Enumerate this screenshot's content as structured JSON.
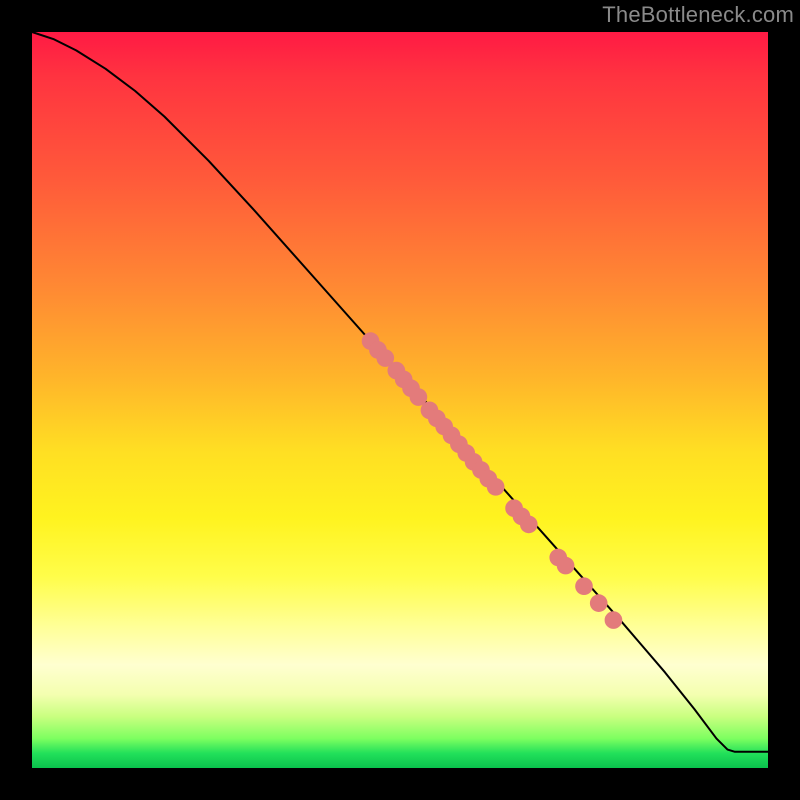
{
  "watermark": "TheBottleneck.com",
  "chart_data": {
    "type": "line",
    "title": "",
    "xlabel": "",
    "ylabel": "",
    "xlim": [
      0,
      100
    ],
    "ylim": [
      0,
      100
    ],
    "grid": false,
    "legend": false,
    "curve": [
      {
        "x": 0,
        "y": 100
      },
      {
        "x": 3,
        "y": 99
      },
      {
        "x": 6,
        "y": 97.5
      },
      {
        "x": 10,
        "y": 95
      },
      {
        "x": 14,
        "y": 92
      },
      {
        "x": 18,
        "y": 88.5
      },
      {
        "x": 24,
        "y": 82.5
      },
      {
        "x": 30,
        "y": 76
      },
      {
        "x": 38,
        "y": 67
      },
      {
        "x": 46,
        "y": 58
      },
      {
        "x": 56,
        "y": 47
      },
      {
        "x": 64,
        "y": 38
      },
      {
        "x": 72,
        "y": 29
      },
      {
        "x": 80,
        "y": 20
      },
      {
        "x": 86,
        "y": 13
      },
      {
        "x": 90,
        "y": 8
      },
      {
        "x": 93,
        "y": 4
      },
      {
        "x": 94.5,
        "y": 2.5
      },
      {
        "x": 95.5,
        "y": 2.2
      },
      {
        "x": 100,
        "y": 2.2
      }
    ],
    "markers": [
      {
        "x": 46.0,
        "y": 58.0
      },
      {
        "x": 47.0,
        "y": 56.8
      },
      {
        "x": 48.0,
        "y": 55.7
      },
      {
        "x": 49.5,
        "y": 54.0
      },
      {
        "x": 50.5,
        "y": 52.8
      },
      {
        "x": 51.5,
        "y": 51.6
      },
      {
        "x": 52.5,
        "y": 50.4
      },
      {
        "x": 54.0,
        "y": 48.6
      },
      {
        "x": 55.0,
        "y": 47.5
      },
      {
        "x": 56.0,
        "y": 46.4
      },
      {
        "x": 57.0,
        "y": 45.2
      },
      {
        "x": 58.0,
        "y": 44.0
      },
      {
        "x": 59.0,
        "y": 42.8
      },
      {
        "x": 60.0,
        "y": 41.6
      },
      {
        "x": 61.0,
        "y": 40.5
      },
      {
        "x": 62.0,
        "y": 39.3
      },
      {
        "x": 63.0,
        "y": 38.2
      },
      {
        "x": 65.5,
        "y": 35.3
      },
      {
        "x": 66.5,
        "y": 34.2
      },
      {
        "x": 67.5,
        "y": 33.1
      },
      {
        "x": 71.5,
        "y": 28.6
      },
      {
        "x": 72.5,
        "y": 27.5
      },
      {
        "x": 75.0,
        "y": 24.7
      },
      {
        "x": 77.0,
        "y": 22.4
      },
      {
        "x": 79.0,
        "y": 20.1
      }
    ],
    "marker_radius": 1.2,
    "marker_color": "#e37b7b",
    "line_color": "#000000"
  }
}
